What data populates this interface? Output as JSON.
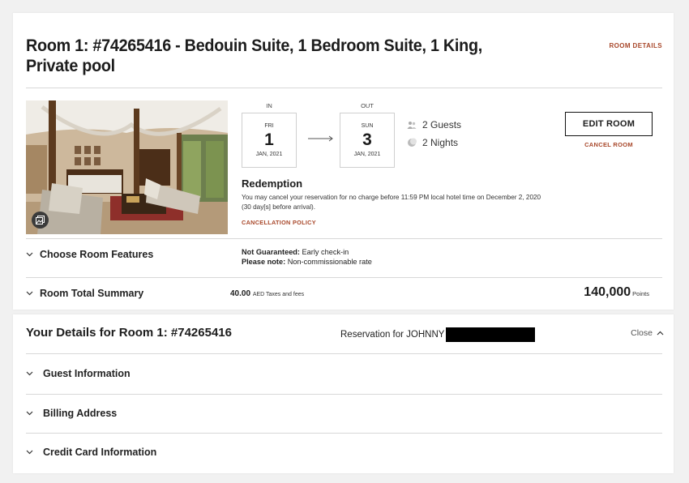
{
  "room": {
    "title": "Room 1: #74265416 - Bedouin Suite, 1 Bedroom Suite, 1 King, Private pool",
    "details_link": "ROOM DETAILS"
  },
  "stay": {
    "in": {
      "label": "IN",
      "dow": "FRI",
      "day": "1",
      "month": "JAN, 2021"
    },
    "out": {
      "label": "OUT",
      "dow": "SUN",
      "day": "3",
      "month": "JAN, 2021"
    },
    "guests": "2 Guests",
    "nights": "2 Nights"
  },
  "actions": {
    "edit_room": "EDIT ROOM",
    "cancel_room": "CANCEL ROOM"
  },
  "redemption": {
    "title": "Redemption",
    "text": "You may cancel your reservation for no charge before 11:59 PM local hotel time on December 2, 2020 (30 day[s] before arrival).",
    "policy_link": "CANCELLATION POLICY"
  },
  "features": {
    "label": "Choose Room Features",
    "not_guaranteed_label": "Not Guaranteed:",
    "not_guaranteed_value": "Early check-in",
    "note_label": "Please note:",
    "note_value": "Non-commissionable rate"
  },
  "summary": {
    "label": "Room Total Summary",
    "taxes_amount": "40.00",
    "taxes_label": "AED Taxes and fees",
    "points_amount": "140,000",
    "points_label": "Points"
  },
  "details": {
    "title": "Your Details for Room 1: #74265416",
    "reservation_for": "Reservation for JOHNNY",
    "close": "Close",
    "sections": [
      "Guest Information",
      "Billing Address",
      "Credit Card Information"
    ]
  },
  "colors": {
    "accent": "#a8472a",
    "text": "#1c1c1c",
    "divider": "#d8d8d8"
  }
}
